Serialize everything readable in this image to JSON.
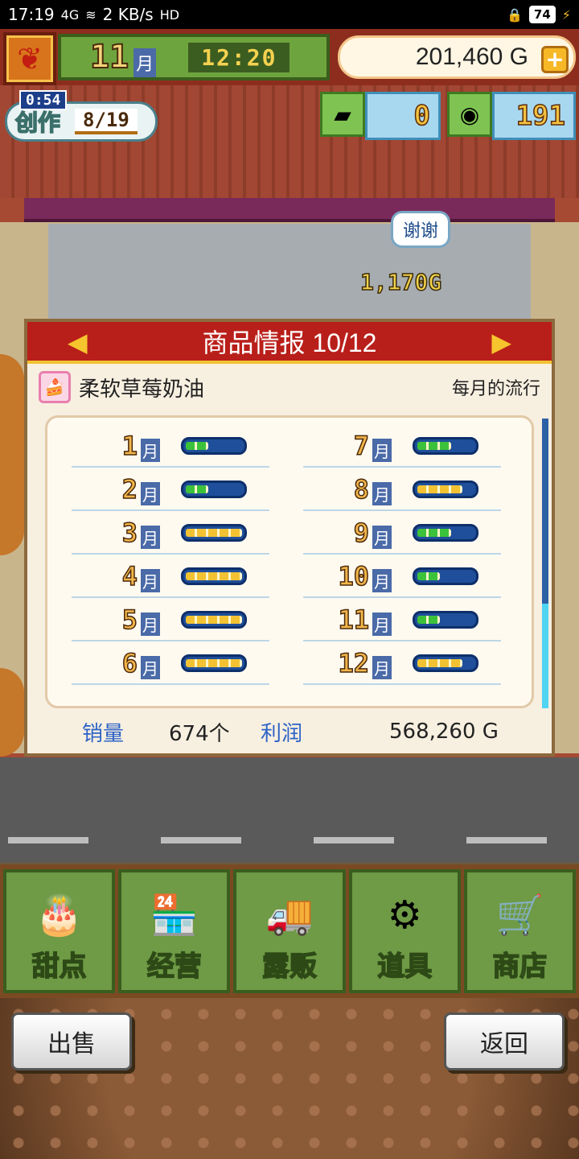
{
  "status_bar": {
    "time": "17:19",
    "signal": "4G",
    "speed": "2 KB/s",
    "hd": "HD",
    "battery": "74"
  },
  "hud": {
    "month_number": "11",
    "month_unit": "月",
    "clock": "12:20",
    "money": "201,460 G",
    "plus": "+"
  },
  "create": {
    "timer": "0:54",
    "label": "创作",
    "count": "8/19"
  },
  "currency": {
    "tickets": "0",
    "coins": "191"
  },
  "scene": {
    "thanks_bubble": "谢谢",
    "earned": "1,170G"
  },
  "panel": {
    "title": "商品情报 10/12",
    "product_name": "柔软草莓奶油",
    "trend_label": "每月的流行",
    "months": [
      {
        "num": "1",
        "unit": "月",
        "level": 2,
        "color": "#3cc23a"
      },
      {
        "num": "2",
        "unit": "月",
        "level": 2,
        "color": "#3cc23a"
      },
      {
        "num": "3",
        "unit": "月",
        "level": 5,
        "color": "#f3c233"
      },
      {
        "num": "4",
        "unit": "月",
        "level": 5,
        "color": "#f3c233"
      },
      {
        "num": "5",
        "unit": "月",
        "level": 5,
        "color": "#f3c233"
      },
      {
        "num": "6",
        "unit": "月",
        "level": 5,
        "color": "#f3c233"
      },
      {
        "num": "7",
        "unit": "月",
        "level": 3,
        "color": "#3cc23a"
      },
      {
        "num": "8",
        "unit": "月",
        "level": 4,
        "color": "#f3c233"
      },
      {
        "num": "9",
        "unit": "月",
        "level": 3,
        "color": "#3cc23a"
      },
      {
        "num": "10",
        "unit": "月",
        "level": 2,
        "color": "#3cc23a"
      },
      {
        "num": "11",
        "unit": "月",
        "level": 2,
        "color": "#3cc23a"
      },
      {
        "num": "12",
        "unit": "月",
        "level": 4,
        "color": "#f3c233"
      }
    ],
    "sales_label": "销量",
    "sales_value": "674个",
    "profit_label": "利润",
    "profit_value": "568,260 G"
  },
  "menu": [
    {
      "label": "甜点",
      "icon": "cake-icon"
    },
    {
      "label": "经营",
      "icon": "shop-icon"
    },
    {
      "label": "露贩",
      "icon": "food-truck-icon"
    },
    {
      "label": "道具",
      "icon": "gear-bag-icon"
    },
    {
      "label": "商店",
      "icon": "shopping-cart-icon"
    }
  ],
  "buttons": {
    "sell": "出售",
    "back": "返回"
  }
}
